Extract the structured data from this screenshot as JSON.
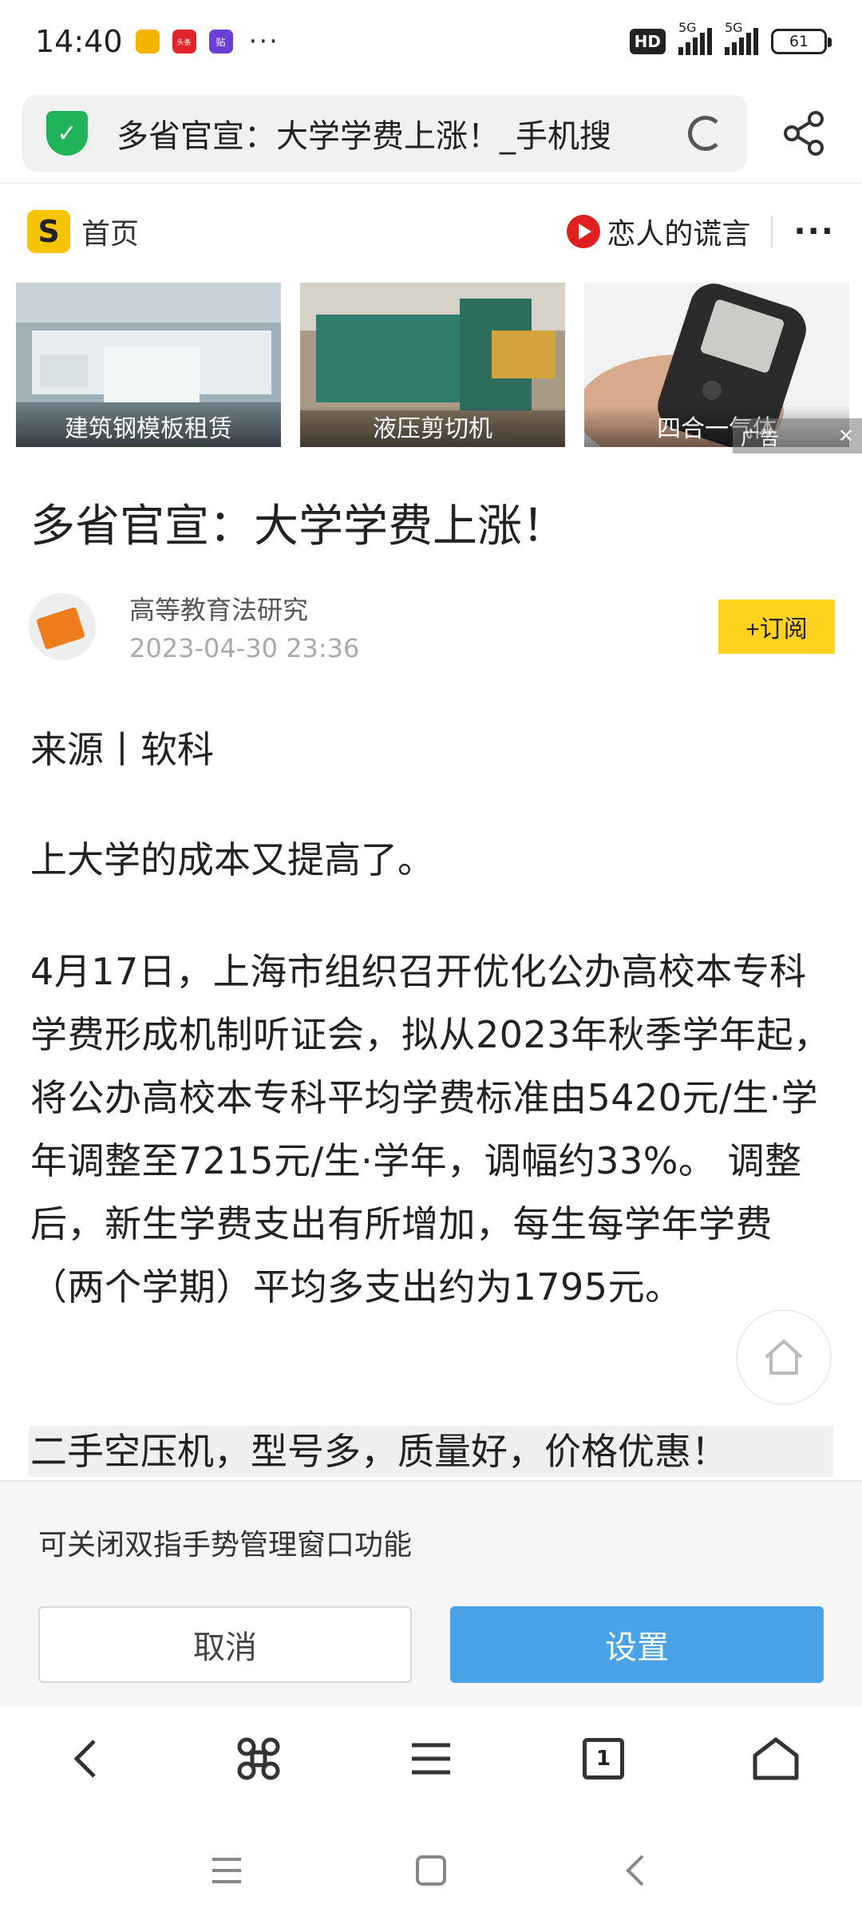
{
  "status_bar": {
    "time": "14:40",
    "app_badges": [
      "头条",
      "贴"
    ],
    "more": "···",
    "network": "HD",
    "signal1_label": "5G",
    "signal2_label": "5G",
    "battery": "61"
  },
  "address_bar": {
    "title": "多省官宣：大学学费上涨！_手机搜"
  },
  "site_header": {
    "logo": "S",
    "home_label": "首页",
    "music_title": "恋人的谎言",
    "more": "···"
  },
  "ads": {
    "items": [
      {
        "label": "建筑钢模板租赁"
      },
      {
        "label": "液压剪切机"
      },
      {
        "label": "四合一气体"
      }
    ],
    "ad_mark": "广告",
    "ad_close": "✕"
  },
  "article": {
    "title": "多省官宣：大学学费上涨！",
    "author": "高等教育法研究",
    "date": "2023-04-30 23:36",
    "subscribe_label": "+订阅",
    "source": "来源丨软科",
    "lead": "上大学的成本又提高了。",
    "body": "4月17日，上海市组织召开优化公办高校本专科学费形成机制听证会，拟从2023年秋季学年起，将公办高校本专科平均学费标准由5420元/生·学年调整至7215元/生·学年，调幅约33%。 调整后，新生学费支出有所增加，每生每学年学费（两个学期）平均多支出约为1795元。",
    "promo": "二手空压机，型号多，质量好，价格优惠！"
  },
  "prompt": {
    "message": "可关闭双指手势管理窗口功能",
    "cancel_label": "取消",
    "settings_label": "设置"
  },
  "toolbar": {
    "tab_count": "1"
  },
  "colors": {
    "accent_blue": "#4aa3e6",
    "subscribe_yellow": "#ffd21e",
    "shield_green": "#20b35a"
  }
}
